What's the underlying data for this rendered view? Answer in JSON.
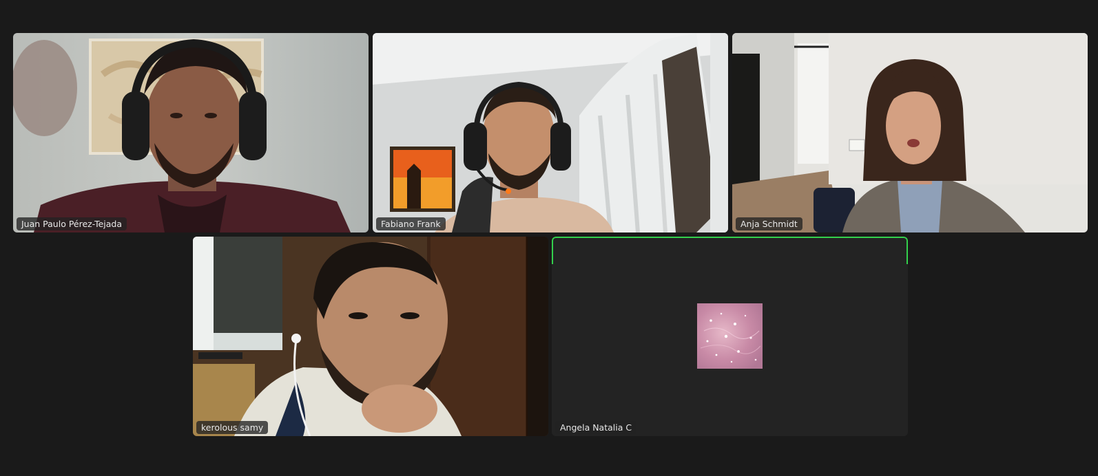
{
  "participants": [
    {
      "name": "Juan Paulo Pérez-Tejada",
      "video": "on"
    },
    {
      "name": "Fabiano Frank",
      "video": "on"
    },
    {
      "name": "Anja Schmidt",
      "video": "on"
    },
    {
      "name": "kerolous samy",
      "video": "on"
    },
    {
      "name": "Angela Natalia C",
      "video": "off",
      "active_speaker": true,
      "avatar": "pink-sparkle-avatar"
    }
  ],
  "colors": {
    "background": "#1a1a1a",
    "tile_empty": "#232323",
    "active_speaker_border": "#33d04c",
    "name_tag_bg": "#232323",
    "name_tag_text": "#e8e8e8"
  }
}
